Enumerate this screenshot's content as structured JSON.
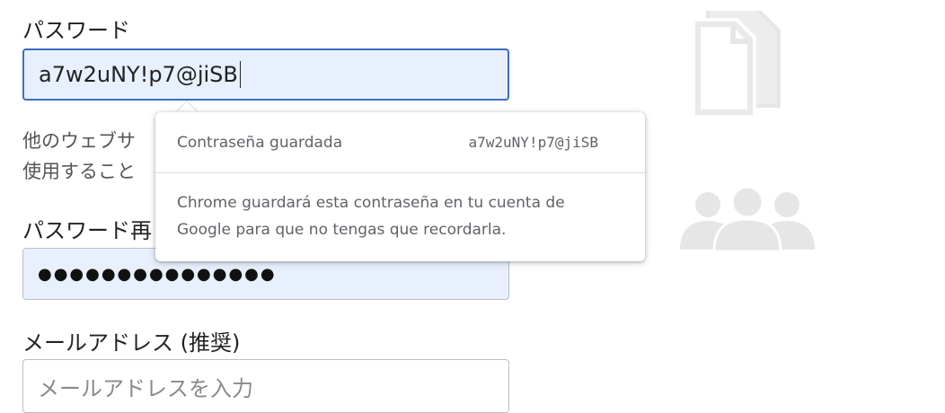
{
  "form": {
    "password_label": "パスワード",
    "password_value": "a7w2uNY!p7@jiSB",
    "help_line1": "他のウェブサ",
    "help_line2": "使用すること",
    "confirm_label": "パスワード再",
    "confirm_value": "●●●●●●●●●●●●●●●",
    "email_label": "メールアドレス (推奨)",
    "email_placeholder": "メールアドレスを入力"
  },
  "popup": {
    "saved_label": "Contraseña guardada",
    "saved_password": "a7w2uNY!p7@jiSB",
    "description": "Chrome guardará esta contraseña en tu cuenta de Google para que no tengas que recordarla."
  },
  "icons": {
    "right_top": "document-copy-icon",
    "right_bottom": "people-group-icon"
  },
  "colors": {
    "focus_border": "#3b6dc8",
    "autofill_bg": "#e8f0fe",
    "icon_gray": "#e6e6e6"
  }
}
